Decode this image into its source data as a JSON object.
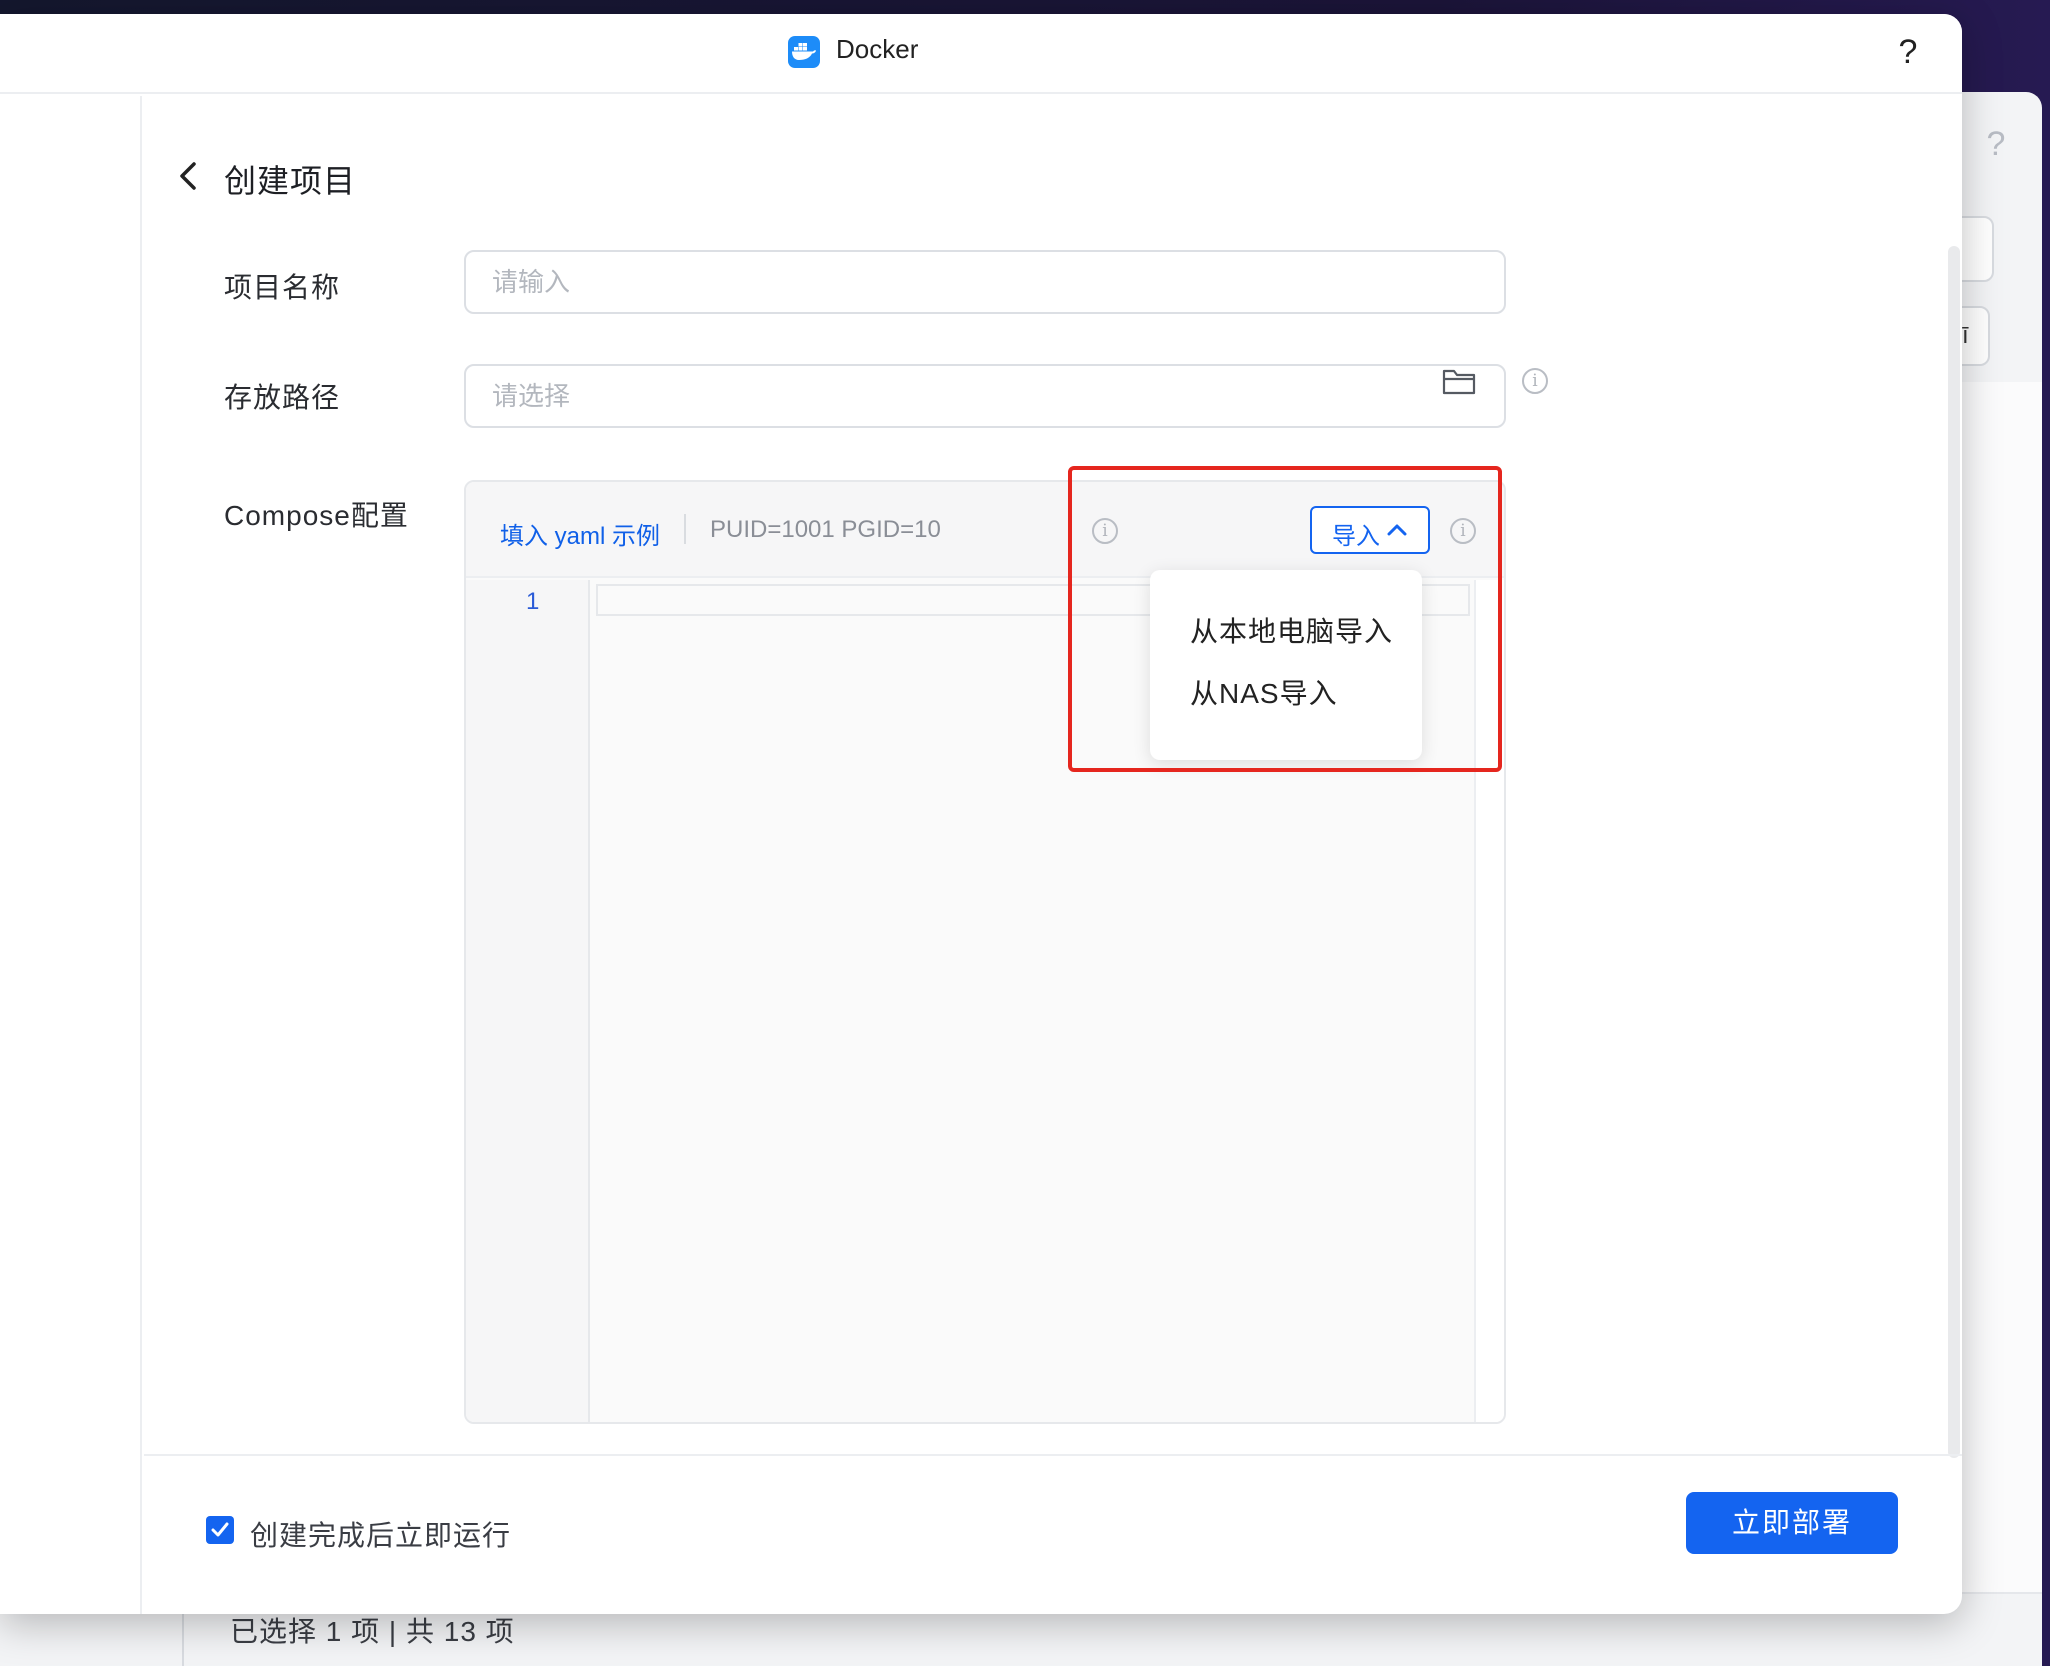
{
  "window": {
    "title": "Docker",
    "help_glyph": "?"
  },
  "background_window": {
    "help_glyph": "?",
    "select_value": "ī",
    "footer_text": "已选择 1 项 | 共 13 项"
  },
  "page": {
    "title": "创建项目"
  },
  "form": {
    "project_name": {
      "label": "项目名称",
      "placeholder": "请输入",
      "value": ""
    },
    "storage_path": {
      "label": "存放路径",
      "placeholder": "请选择",
      "value": ""
    },
    "compose": {
      "label": "Compose配置",
      "yaml_example_link": "填入 yaml 示例",
      "puid_info": "PUID=1001 PGID=10",
      "import_button": "导入",
      "line_numbers": [
        "1"
      ],
      "editor_content": ""
    }
  },
  "import_menu": {
    "items": [
      "从本地电脑导入",
      "从NAS导入"
    ]
  },
  "footer": {
    "run_after_create_label": "创建完成后立即运行",
    "run_after_create_checked": true,
    "deploy_button": "立即部署"
  },
  "colors": {
    "accent": "#1464f0",
    "highlight": "#e5261e",
    "docker_icon": "#1d8cf8"
  },
  "icons": {
    "back": "chevron-left-icon",
    "folder": "folder-icon",
    "info": "info-icon",
    "import_caret": "chevron-up-icon",
    "check": "check-icon",
    "app": "docker-icon"
  }
}
